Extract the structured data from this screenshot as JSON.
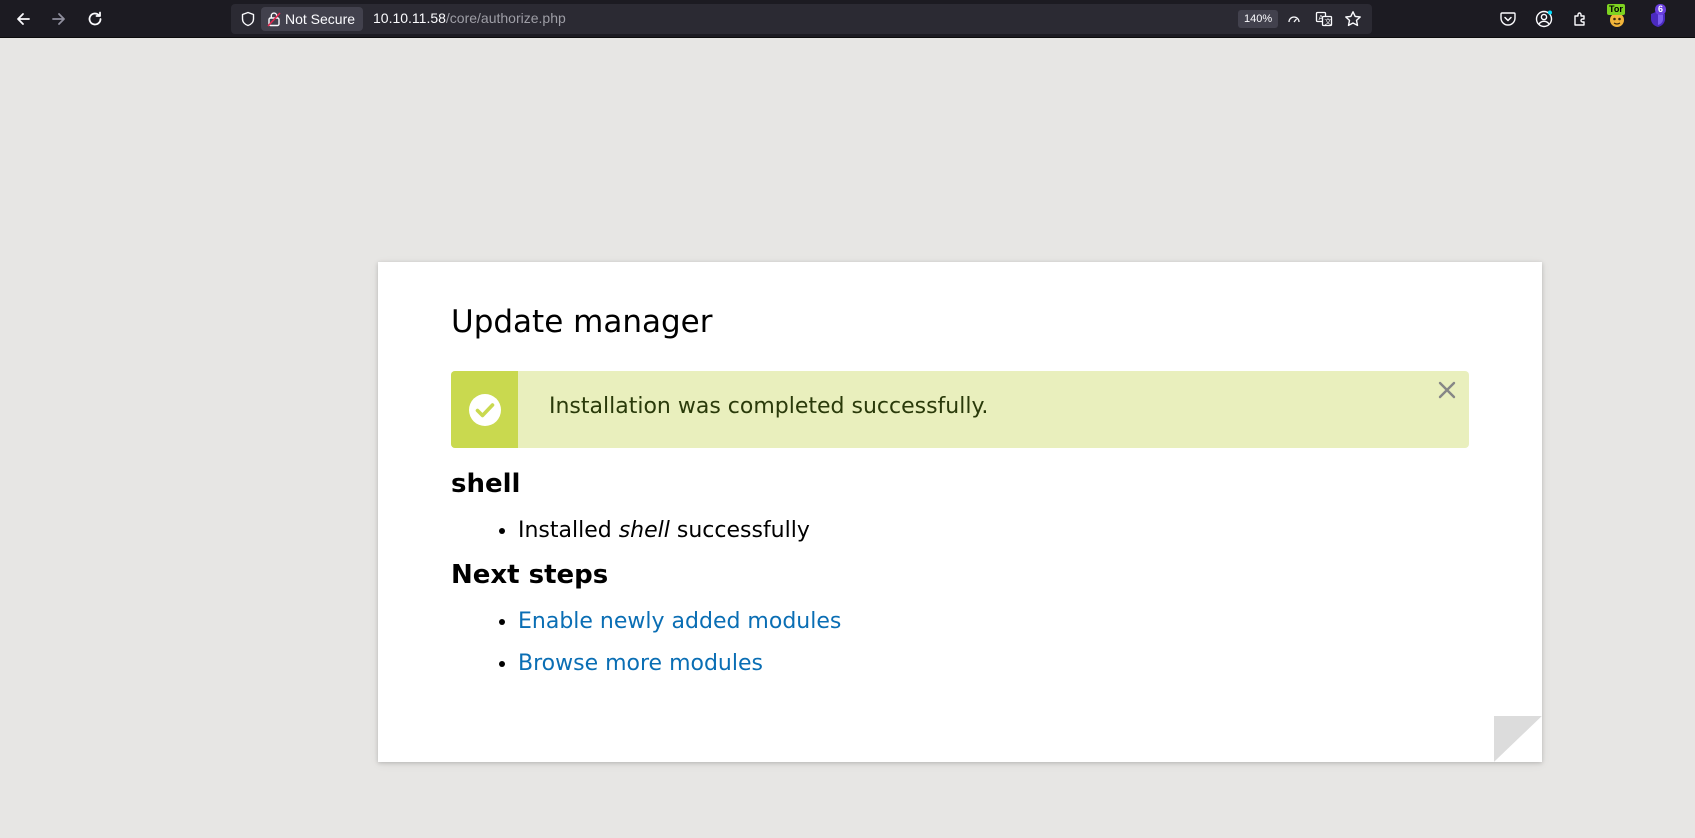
{
  "browser": {
    "not_secure_label": "Not Secure",
    "url_host": "10.10.11.58",
    "url_path": "/core/authorize.php",
    "zoom": "140%",
    "tor_badge": "Tor",
    "extension_badge_count": "6"
  },
  "page": {
    "title": "Update manager",
    "message": {
      "text": "Installation was completed successfully.",
      "type": "status",
      "icon": "check-circle-icon",
      "accent_color": "#c9d94f",
      "background_color": "#e9efbd"
    },
    "module_section": {
      "heading": "shell",
      "items": [
        {
          "prefix": "Installed ",
          "module": "shell",
          "suffix": " successfully"
        }
      ]
    },
    "next_steps": {
      "heading": "Next steps",
      "links": [
        {
          "label": "Enable newly added modules"
        },
        {
          "label": "Browse more modules"
        }
      ],
      "link_color": "#0a6eb4"
    }
  }
}
